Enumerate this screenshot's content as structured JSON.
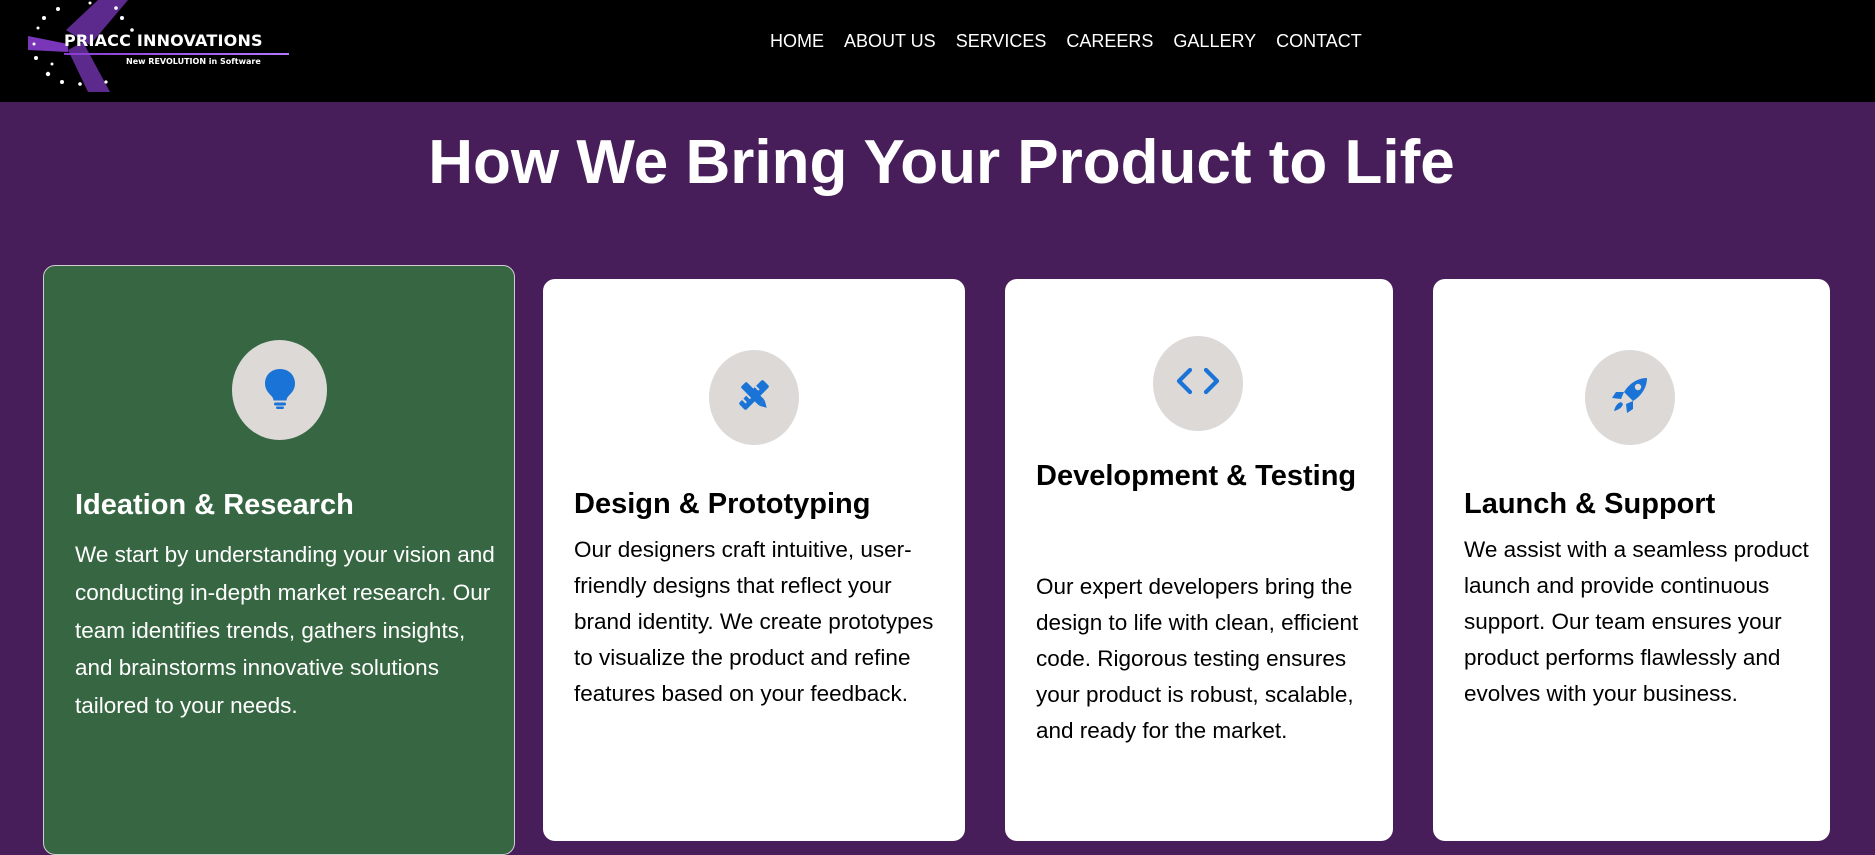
{
  "header": {
    "logo": {
      "name": "PRIACC INNOVATIONS",
      "tagline": "New REVOLUTION in Software"
    },
    "nav": [
      {
        "label": "HOME"
      },
      {
        "label": "ABOUT US"
      },
      {
        "label": "SERVICES"
      },
      {
        "label": "CAREERS"
      },
      {
        "label": "GALLERY"
      },
      {
        "label": "CONTACT"
      }
    ]
  },
  "section": {
    "title": "How We Bring Your Product to Life",
    "cards": [
      {
        "icon": "lightbulb-icon",
        "title": "Ideation & Research",
        "text": "We start by understanding your vision and conducting in-depth market research. Our team identifies trends, gathers insights, and brainstorms innovative solutions tailored to your needs."
      },
      {
        "icon": "design-tools-icon",
        "title": "Design & Prototyping",
        "text": "Our designers craft intuitive, user-friendly designs that reflect your brand identity. We create prototypes to visualize the product and refine features based on your feedback."
      },
      {
        "icon": "code-icon",
        "title": "Development & Testing",
        "text": "Our expert developers bring the design to life with clean, efficient code. Rigorous testing ensures your product is robust, scalable, and ready for the market."
      },
      {
        "icon": "rocket-icon",
        "title": "Launch & Support",
        "text": "We assist with a seamless product launch and provide continuous support. Our team ensures your product performs flawlessly and evolves with your business."
      }
    ]
  },
  "colors": {
    "header_bg": "#000000",
    "section_bg": "#481e5a",
    "active_card_bg": "#376742",
    "card_bg": "#ffffff",
    "icon_circle_bg": "#dcd9d7",
    "icon_color": "#1a73d6"
  }
}
